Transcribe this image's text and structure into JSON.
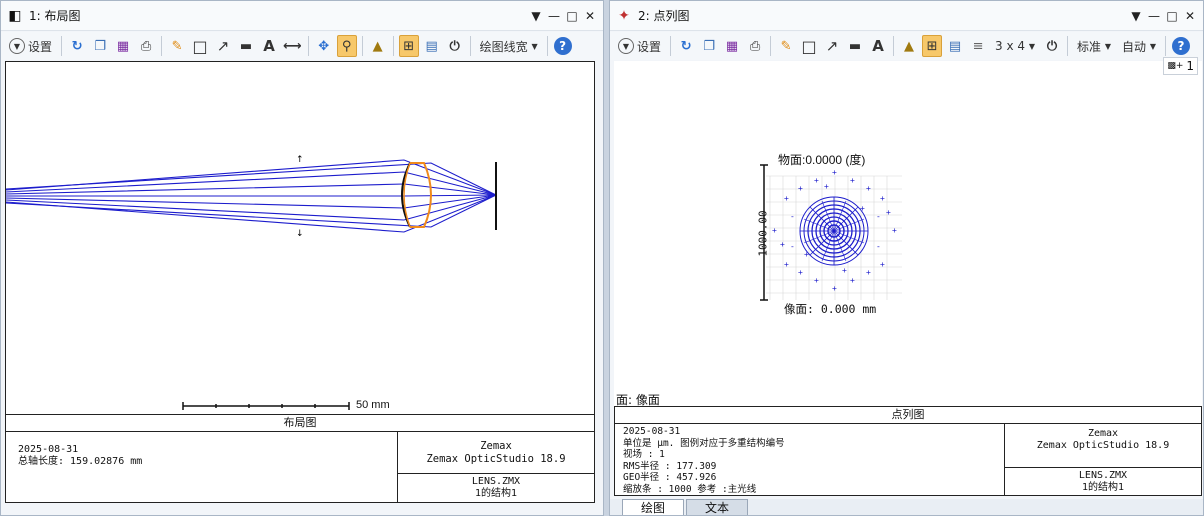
{
  "window1": {
    "title": "1: 布局图",
    "toolbar": {
      "settings_label": "设置",
      "line_width_label": "绘图线宽"
    },
    "plot": {
      "scale_bar_label": "50 mm"
    },
    "footer": {
      "title": "布局图",
      "date": "2025-08-31",
      "total_length": "总轴长度:  159.02876 mm",
      "company": "Zemax",
      "product": "Zemax OpticStudio 18.9",
      "file": "LENS.ZMX",
      "config": "1的结构1"
    }
  },
  "window2": {
    "title": "2: 点列图",
    "toolbar": {
      "settings_label": "设置",
      "grid_label": "3 x 4",
      "standard_label": "标准",
      "auto_label": "自动"
    },
    "config_badge": "1",
    "plot": {
      "field_label": "物面:0.0000 (度)",
      "scale_label": "1000.00",
      "image_label": "像面: 0.000 mm"
    },
    "surface_label": "面: 像面",
    "footer": {
      "title": "点列图",
      "date": "2025-08-31",
      "units_line": "单位是 μm. 图例对应于多重结构编号",
      "field_line": "视场      :       1",
      "rms_line": "RMS半径 :  177.309",
      "geo_line": "GEO半径 :  457.926",
      "scale_line": "缩放条  :     1000      参考  :主光线",
      "company": "Zemax",
      "product": "Zemax OpticStudio 18.9",
      "file": "LENS.ZMX",
      "config": "1的结构1"
    },
    "tabs": [
      {
        "label": "绘图"
      },
      {
        "label": "文本"
      }
    ]
  },
  "colors": {
    "ray_blue": "#1c1ccc",
    "lens_orange": "#f08a1c",
    "accent_active": "#f7c86a"
  }
}
